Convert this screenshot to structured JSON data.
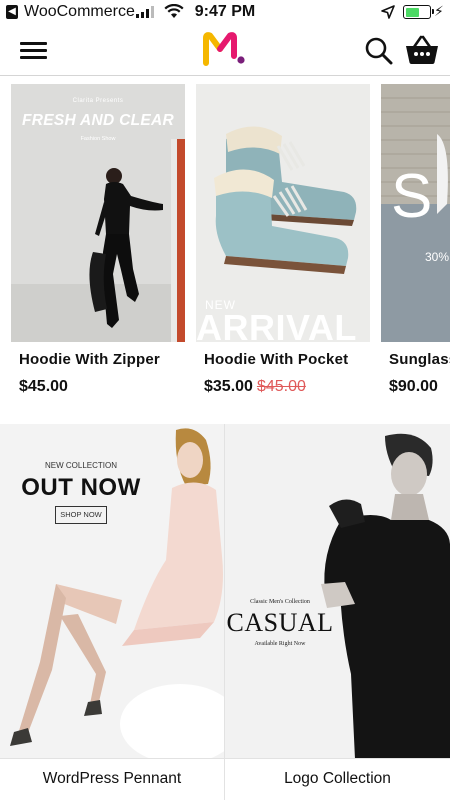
{
  "status_bar": {
    "back_app": "WooCommerce",
    "time": "9:47 PM",
    "signal_icon": "cellular-signal-icon",
    "wifi_icon": "wifi-icon",
    "location_icon": "location-arrow-icon",
    "battery_icon": "battery-icon",
    "battery_level": 0.6,
    "charging_icon": "charging-bolt-icon"
  },
  "header": {
    "menu_icon": "hamburger-menu-icon",
    "logo_icon": "m-logo-icon",
    "search_icon": "search-icon",
    "cart_icon": "shopping-basket-icon"
  },
  "products": [
    {
      "title": "Hoodie With Zipper",
      "price": "$45.00",
      "old_price": "",
      "image_text": {
        "brand": "Clarita Presents",
        "headline": "FRESH AND CLEAR",
        "sub": "Fashion Show"
      }
    },
    {
      "title": "Hoodie With Pocket",
      "price": "$35.00",
      "old_price": "$45.00",
      "image_text": {
        "small": "NEW",
        "big": "ARRIVAL"
      }
    },
    {
      "title": "Sunglass",
      "price": "$90.00",
      "old_price": "",
      "image_text": {
        "big": "S",
        "small": "30%"
      }
    }
  ],
  "collections": [
    {
      "label": "WordPress Pennant",
      "image_text": {
        "kicker": "NEW COLLECTION",
        "headline": "OUT NOW",
        "cta": "SHOP NOW"
      }
    },
    {
      "label": "Logo Collection",
      "image_text": {
        "kicker": "Classic Men's Collection",
        "headline": "CASUAL",
        "sub": "Available Right Now"
      }
    }
  ],
  "colors": {
    "accent_pink": "#e6196e",
    "accent_yellow": "#f5b700",
    "accent_purple": "#7a1f7a",
    "old_price_red": "#e05a5a",
    "battery_green": "#4cd964"
  }
}
